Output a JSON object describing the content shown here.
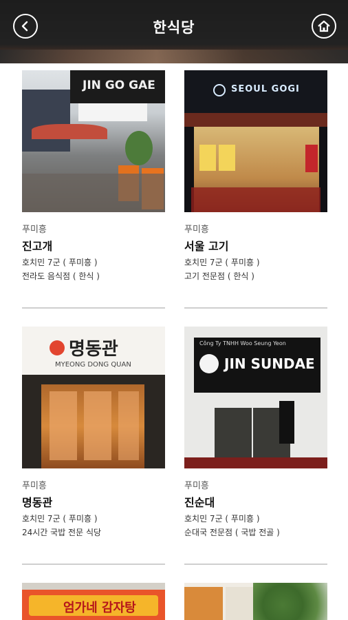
{
  "header": {
    "title": "한식당",
    "back_icon": "chevron-left-icon",
    "home_icon": "home-icon"
  },
  "restaurants": [
    {
      "area": "푸미흥",
      "name": "진고개",
      "address": "호치민 7군 ( 푸미흥 )",
      "category": "전라도 음식점 ( 한식 )",
      "sign": "JIN GO GAE"
    },
    {
      "area": "푸미흥",
      "name": "서울 고기",
      "address": "호치민 7군 ( 푸미흥 )",
      "category": "고기 전문점 ( 한식 )",
      "sign": "SEOUL GOGI"
    },
    {
      "area": "푸미흥",
      "name": "명동관",
      "address": "호치민 7군 ( 푸미흥 )",
      "category": "24시간 국밥 전문 식당",
      "sign": "명동관",
      "sign_sub": "MYEONG DONG QUAN"
    },
    {
      "area": "푸미흥",
      "name": "진순대",
      "address": "호치민 7군 ( 푸미흥 )",
      "category": "순대국 전문점 ( 국밥 전골 )",
      "sign": "JIN SUNDAE",
      "sign_sub": "Công Ty TNHH Woo Seung Yeon"
    }
  ],
  "partial_cards": [
    {
      "sign": "엄가네 감자탕"
    },
    {
      "sign": ""
    }
  ]
}
